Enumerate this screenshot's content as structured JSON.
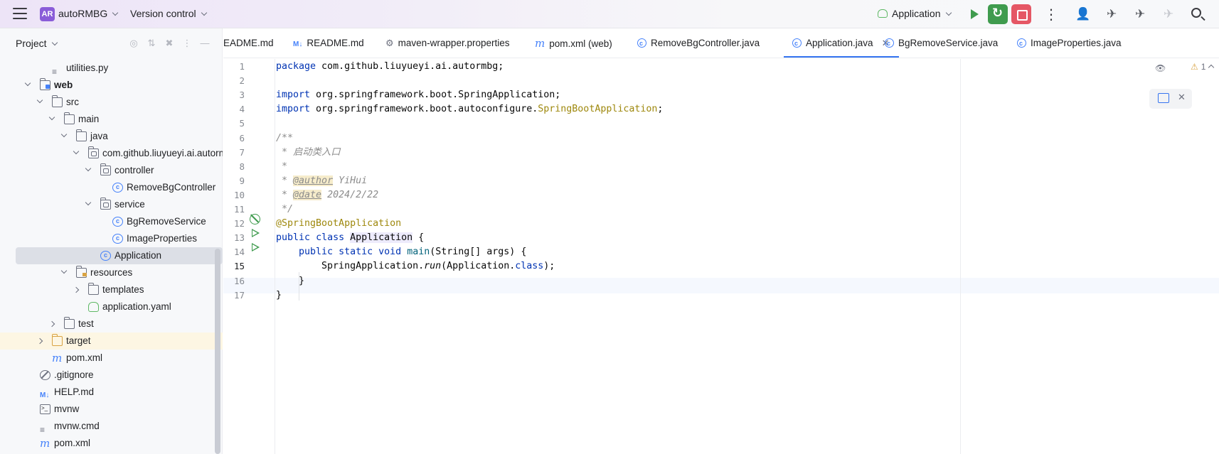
{
  "topbar": {
    "project_badge": "AR",
    "project_name": "autoRMBG",
    "version_control": "Version control",
    "run_config": "Application"
  },
  "project_panel": {
    "title": "Project",
    "tree": [
      {
        "label": "utilities.py",
        "depth": 3,
        "icon": "file"
      },
      {
        "label": "web",
        "depth": 2,
        "icon": "module-folder",
        "expanded": true,
        "bold": true
      },
      {
        "label": "src",
        "depth": 3,
        "icon": "folder",
        "expanded": true
      },
      {
        "label": "main",
        "depth": 4,
        "icon": "folder",
        "expanded": true
      },
      {
        "label": "java",
        "depth": 5,
        "icon": "source-folder",
        "expanded": true
      },
      {
        "label": "com.github.liuyueyi.ai.autormbg",
        "depth": 6,
        "icon": "package",
        "expanded": true
      },
      {
        "label": "controller",
        "depth": 7,
        "icon": "package",
        "expanded": true
      },
      {
        "label": "RemoveBgController",
        "depth": 8,
        "icon": "class"
      },
      {
        "label": "service",
        "depth": 7,
        "icon": "package",
        "expanded": true
      },
      {
        "label": "BgRemoveService",
        "depth": 8,
        "icon": "class"
      },
      {
        "label": "ImageProperties",
        "depth": 8,
        "icon": "class"
      },
      {
        "label": "Application",
        "depth": 7,
        "icon": "spring-class",
        "selected": true
      },
      {
        "label": "resources",
        "depth": 5,
        "icon": "resources-folder",
        "expanded": true
      },
      {
        "label": "templates",
        "depth": 6,
        "icon": "folder",
        "expanded": false
      },
      {
        "label": "application.yaml",
        "depth": 6,
        "icon": "yaml"
      },
      {
        "label": "test",
        "depth": 4,
        "icon": "folder",
        "expanded": false
      },
      {
        "label": "target",
        "depth": 3,
        "icon": "target-folder",
        "expanded": false
      },
      {
        "label": "pom.xml",
        "depth": 3,
        "icon": "maven"
      },
      {
        "label": ".gitignore",
        "depth": 2,
        "icon": "ignore"
      },
      {
        "label": "HELP.md",
        "depth": 2,
        "icon": "markdown"
      },
      {
        "label": "mvnw",
        "depth": 2,
        "icon": "terminal"
      },
      {
        "label": "mvnw.cmd",
        "depth": 2,
        "icon": "text"
      },
      {
        "label": "pom.xml",
        "depth": 2,
        "icon": "maven"
      }
    ]
  },
  "tabs": [
    {
      "label": "ai\\README.md",
      "icon": "none"
    },
    {
      "label": "README.md",
      "icon": "markdown"
    },
    {
      "label": "maven-wrapper.properties",
      "icon": "gear"
    },
    {
      "label": "pom.xml (web)",
      "icon": "maven"
    },
    {
      "label": "RemoveBgController.java",
      "icon": "class"
    },
    {
      "label": "Application.java",
      "icon": "spring-class",
      "active": true
    },
    {
      "label": "BgRemoveService.java",
      "icon": "class"
    },
    {
      "label": "ImageProperties.java",
      "icon": "class"
    }
  ],
  "editor": {
    "inspection_count": "1",
    "current_line": 15,
    "lines": [
      "package com.github.liuyueyi.ai.autormbg;",
      "",
      "import org.springframework.boot.SpringApplication;",
      "import org.springframework.boot.autoconfigure.SpringBootApplication;",
      "",
      "/**",
      " * 启动类入口",
      " *",
      " * @author YiHui",
      " * @date 2024/2/22",
      " */",
      "@SpringBootApplication",
      "public class Application {",
      "    public static void main(String[] args) {",
      "        SpringApplication.run(Application.class);",
      "    }",
      "}"
    ]
  }
}
